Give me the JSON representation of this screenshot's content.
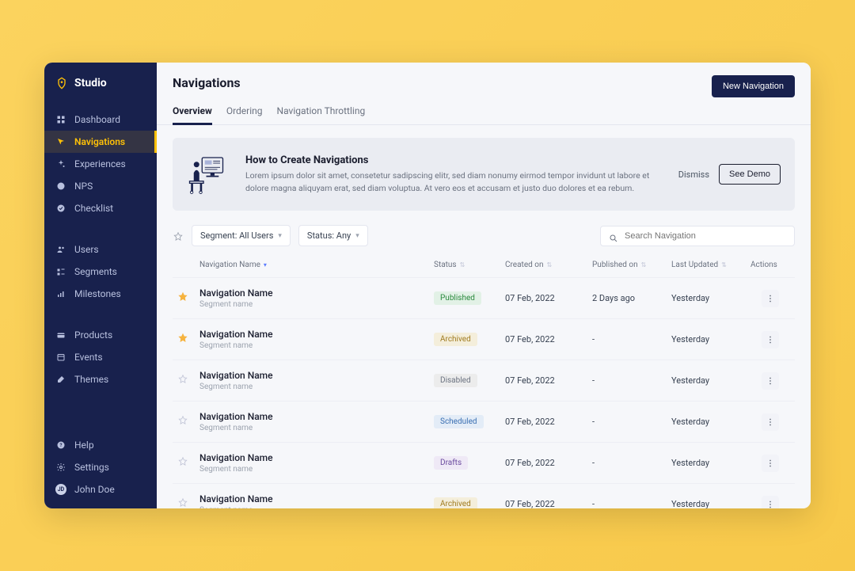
{
  "brand": {
    "name": "Studio"
  },
  "sidebar": {
    "group1": [
      {
        "label": "Dashboard",
        "icon": "dashboard"
      },
      {
        "label": "Navigations",
        "icon": "cursor",
        "active": true
      },
      {
        "label": "Experiences",
        "icon": "sparkle"
      },
      {
        "label": "NPS",
        "icon": "smile"
      },
      {
        "label": "Checklist",
        "icon": "check"
      }
    ],
    "group2": [
      {
        "label": "Users",
        "icon": "users"
      },
      {
        "label": "Segments",
        "icon": "segments"
      },
      {
        "label": "Milestones",
        "icon": "milestones"
      }
    ],
    "group3": [
      {
        "label": "Products",
        "icon": "products"
      },
      {
        "label": "Events",
        "icon": "calendar"
      },
      {
        "label": "Themes",
        "icon": "themes"
      }
    ],
    "bottom": [
      {
        "label": "Help",
        "icon": "help"
      },
      {
        "label": "Settings",
        "icon": "gear"
      },
      {
        "label": "John Doe",
        "icon": "avatar",
        "initials": "JD"
      }
    ]
  },
  "page": {
    "title": "Navigations",
    "new_button": "New Navigation"
  },
  "tabs": [
    {
      "label": "Overview",
      "active": true
    },
    {
      "label": "Ordering"
    },
    {
      "label": "Navigation Throttling"
    }
  ],
  "banner": {
    "title": "How to Create Navigations",
    "desc": "Lorem ipsum dolor sit amet, consetetur sadipscing elitr, sed diam nonumy eirmod tempor invidunt ut labore et dolore magna aliquyam erat, sed diam voluptua. At vero eos et accusam et justo duo dolores et ea rebum.",
    "dismiss": "Dismiss",
    "cta": "See Demo"
  },
  "filters": {
    "segment": "Segment: All Users",
    "status": "Status: Any"
  },
  "search": {
    "placeholder": "Search Navigation"
  },
  "columns": {
    "name": "Navigation Name",
    "status": "Status",
    "created": "Created on",
    "published": "Published on",
    "updated": "Last Updated",
    "actions": "Actions"
  },
  "rows": [
    {
      "starred": true,
      "name": "Navigation Name",
      "segment": "Segment name",
      "status": "Published",
      "created": "07 Feb, 2022",
      "published": "2 Days ago",
      "updated": "Yesterday"
    },
    {
      "starred": true,
      "name": "Navigation Name",
      "segment": "Segment name",
      "status": "Archived",
      "created": "07 Feb, 2022",
      "published": "-",
      "updated": "Yesterday"
    },
    {
      "starred": false,
      "name": "Navigation Name",
      "segment": "Segment name",
      "status": "Disabled",
      "created": "07 Feb, 2022",
      "published": "-",
      "updated": "Yesterday"
    },
    {
      "starred": false,
      "name": "Navigation Name",
      "segment": "Segment name",
      "status": "Scheduled",
      "created": "07 Feb, 2022",
      "published": "-",
      "updated": "Yesterday"
    },
    {
      "starred": false,
      "name": "Navigation Name",
      "segment": "Segment name",
      "status": "Drafts",
      "created": "07 Feb, 2022",
      "published": "-",
      "updated": "Yesterday"
    },
    {
      "starred": false,
      "name": "Navigation Name",
      "segment": "Segment name",
      "status": "Archived",
      "created": "07 Feb, 2022",
      "published": "-",
      "updated": "Yesterday"
    }
  ]
}
